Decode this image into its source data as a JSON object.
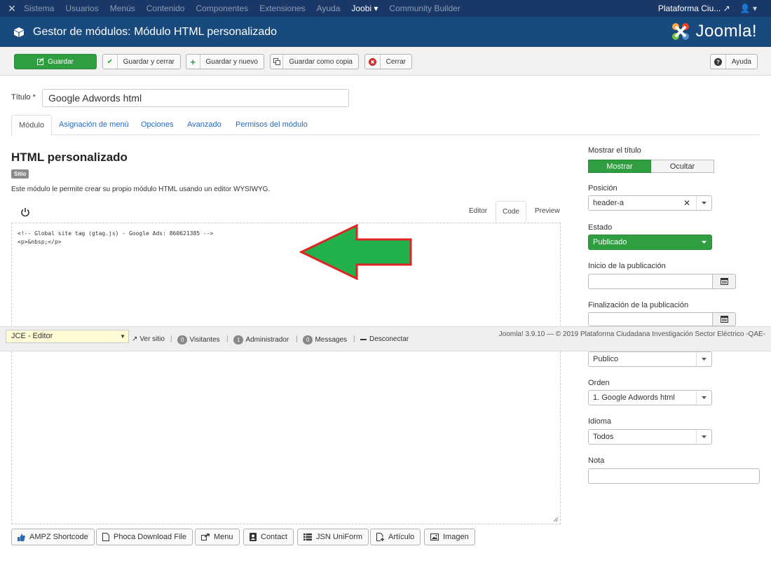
{
  "topnav": {
    "items": [
      "Sistema",
      "Usuarios",
      "Menús",
      "Contenido",
      "Componentes",
      "Extensiones",
      "Ayuda",
      "Joobi ▾",
      "Community Builder"
    ],
    "site": "Plataforma Ciu...",
    "user_caret": "▾"
  },
  "header": {
    "title": "Gestor de módulos: Módulo HTML personalizado",
    "logo_text": "Joomla!"
  },
  "toolbar": {
    "save": "Guardar",
    "save_close": "Guardar y cerrar",
    "save_new": "Guardar y nuevo",
    "save_copy": "Guardar como copia",
    "close": "Cerrar",
    "help": "Ayuda"
  },
  "form": {
    "title_label": "Título *",
    "title_value": "Google Adwords html"
  },
  "tabs": [
    "Módulo",
    "Asignación de menú",
    "Opciones",
    "Avanzado",
    "Permisos del módulo"
  ],
  "module": {
    "heading": "HTML personalizado",
    "badge": "Sitio",
    "description": "Este módulo le permite crear su propio módulo HTML usando un editor WYSIWYG."
  },
  "editor": {
    "tabs": [
      "Editor",
      "Code",
      "Preview"
    ],
    "lines": [
      "<!-- Global site tag (gtag.js) - Google Ads: 860621385 -->",
      "<p>&nbsp;</p>"
    ]
  },
  "bottom_buttons": [
    "AMPZ Shortcode",
    "Phoca Download File",
    "Menu",
    "Contact",
    "JSN UniForm",
    "Artículo",
    "Imagen"
  ],
  "sidebar": {
    "show_title_label": "Mostrar el título",
    "show": "Mostrar",
    "hide": "Ocultar",
    "position_label": "Posición",
    "position_value": "header-a",
    "state_label": "Estado",
    "state_value": "Publicado",
    "pub_start_label": "Inicio de la publicación",
    "pub_end_label": "Finalización de la publicación",
    "access_value": "Publico",
    "order_label": "Orden",
    "order_value": "1. Google Adwords html",
    "language_label": "Idioma",
    "language_value": "Todos",
    "note_label": "Nota"
  },
  "statusbar": {
    "editor_select": "JCE - Editor",
    "view_site": "Ver sitio",
    "visitors_count": "0",
    "visitors": "Visitantes",
    "admin_count": "1",
    "admin": "Administrador",
    "messages_count": "0",
    "messages": "Messages",
    "logout": "Desconectar",
    "copyright": "Joomla! 3.9.10 — © 2019 Plataforma Ciudadana Investigación Sector Eléctrico -QAE-"
  },
  "colors": {
    "nav": "#1a3867",
    "header": "#184a7d",
    "success": "#2f9e41",
    "arrow_fill": "#22b14c",
    "arrow_stroke": "#e02424"
  }
}
